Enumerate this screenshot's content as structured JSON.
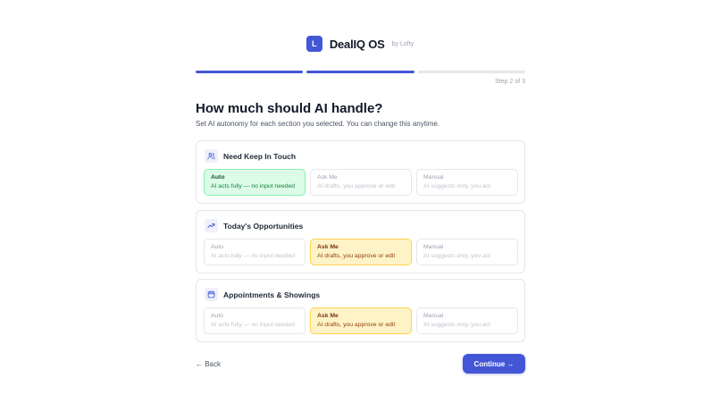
{
  "brand": {
    "logo_letter": "L",
    "name": "DealIQ OS",
    "by": "by Lofty",
    "accent": "#4357d6"
  },
  "progress": {
    "current_step": 2,
    "total_steps": 3,
    "label": "Step 2 of 3"
  },
  "heading": {
    "title": "How much should AI handle?",
    "subtitle": "Set AI autonomy for each section you selected. You can change this anytime."
  },
  "sections": [
    {
      "title": "Need Keep In Touch",
      "icon": "users-icon",
      "selected": "auto",
      "options": [
        {
          "label": "Auto",
          "desc": "AI acts fully — no input needed"
        },
        {
          "label": "Ask Me",
          "desc": "AI drafts, you approve or edit"
        },
        {
          "label": "Manual",
          "desc": "AI suggests only, you act"
        }
      ]
    },
    {
      "title": "Today's Opportunities",
      "icon": "trending-up-icon",
      "selected": "ask",
      "options": [
        {
          "label": "Auto",
          "desc": "AI acts fully — no input needed"
        },
        {
          "label": "Ask Me",
          "desc": "AI drafts, you approve or edit"
        },
        {
          "label": "Manual",
          "desc": "AI suggests only, you act"
        }
      ]
    },
    {
      "title": "Appointments & Showings",
      "icon": "calendar-icon",
      "selected": "ask",
      "options": [
        {
          "label": "Auto",
          "desc": "AI acts fully — no input needed"
        },
        {
          "label": "Ask Me",
          "desc": "AI drafts, you approve or edit"
        },
        {
          "label": "Manual",
          "desc": "AI suggests only, you act"
        }
      ]
    }
  ],
  "footer": {
    "back_label": "← Back",
    "continue_label": "Continue →"
  }
}
